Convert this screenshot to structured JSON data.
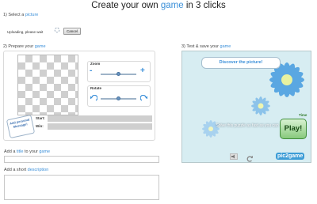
{
  "page": {
    "title_prefix": "Create your own ",
    "title_highlight": "game",
    "title_suffix": " in 3 clicks"
  },
  "step1": {
    "prefix": "1) Select a ",
    "link": "picture",
    "status": "Uploading, please wait",
    "cancel_label": "Cancel"
  },
  "step2": {
    "prefix": "2) Prepare your ",
    "link": "game",
    "zoom_label": "Zoom",
    "zoom_minus": "-",
    "zoom_plus": "+",
    "zoom_level": 0.5,
    "rotate_label": "Rotate",
    "rotate_level": 0.5,
    "sticker_text": "Add personal Message!",
    "start_label": "Start:",
    "start_value": "",
    "win_label": "Win:",
    "win_value": ""
  },
  "step3": {
    "prefix": "3) Test & save your ",
    "link": "game",
    "bubble_text": "Discover the picture!",
    "instruction": "Solve this puzzle as fast as you can",
    "play_label": "Play!",
    "time_label": "Time",
    "logo_text": "pic2game"
  },
  "form": {
    "title_label_prefix": "Add a ",
    "title_label_link": "title",
    "title_label_suffix": " to your ",
    "title_label_link2": "game",
    "title_value": "",
    "desc_label_prefix": "Add a short ",
    "desc_label_link": "description",
    "desc_value": ""
  },
  "colors": {
    "link": "#3a8fd9",
    "play_green": "#87c97c",
    "preview_bg": "#d7edf2"
  }
}
